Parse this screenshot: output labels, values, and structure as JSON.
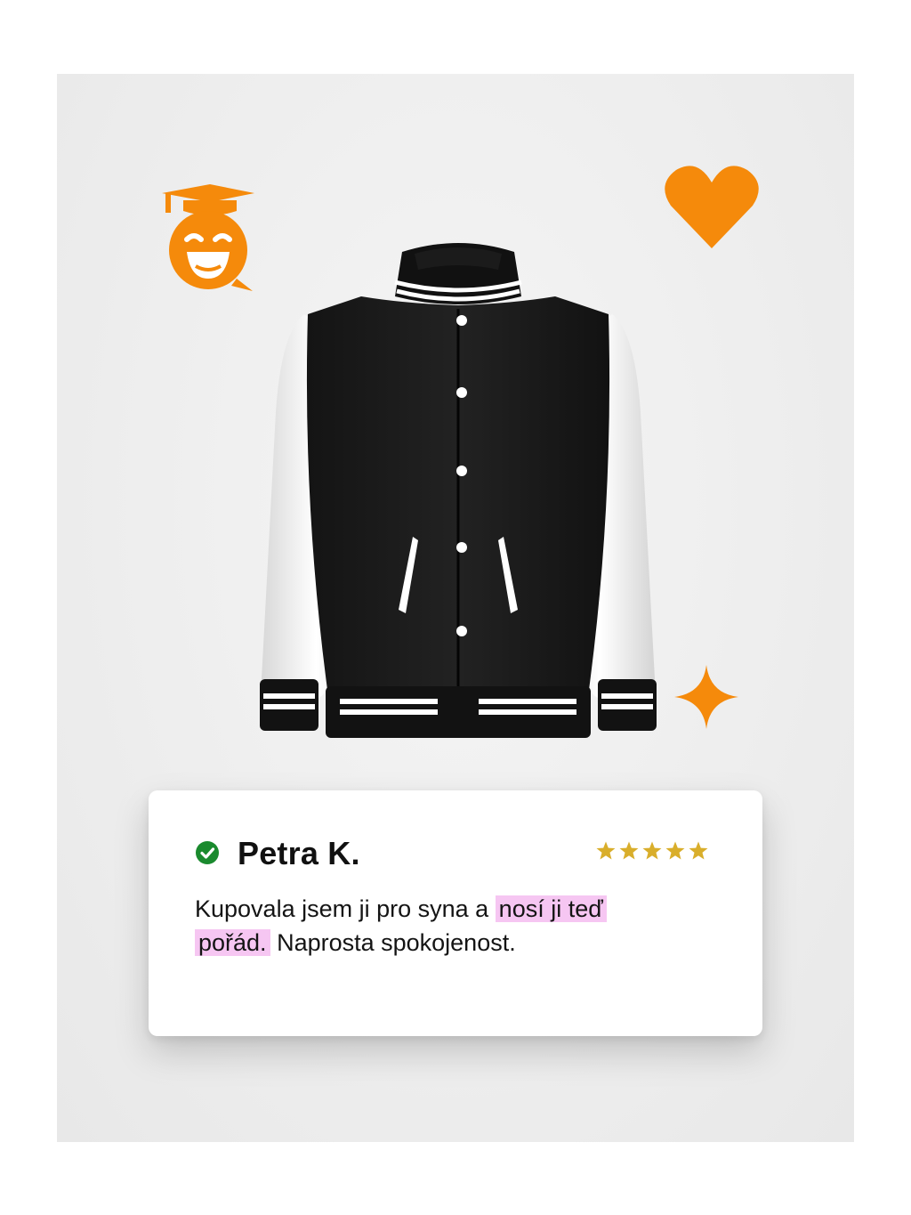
{
  "review": {
    "name": "Petra K.",
    "rating": 5,
    "text_before": "Kupovala jsem ji pro syna a ",
    "text_highlight_1": "nosí ji teď",
    "text_highlight_2": "pořád.",
    "text_after": " Naprosta spokojenost."
  },
  "colors": {
    "accent_orange": "#f58a0b",
    "highlight_pink": "#f6c6f2",
    "verified_green": "#1a8a2e",
    "star_gold": "#d9ae2b"
  },
  "icons": [
    "graduate-smiley-icon",
    "heart-icon",
    "sparkle-icon",
    "check-circle-icon",
    "star-icon"
  ]
}
